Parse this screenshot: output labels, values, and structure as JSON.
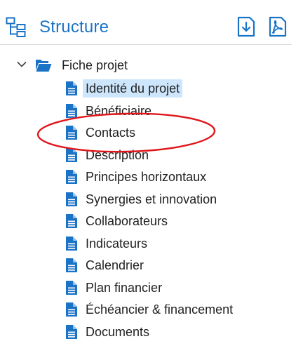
{
  "header": {
    "title": "Structure",
    "icon": "tree-structure-icon",
    "actions": [
      {
        "name": "export-document-icon"
      },
      {
        "name": "export-pdf-icon"
      }
    ]
  },
  "tree": {
    "root": {
      "label": "Fiche projet",
      "expanded": true,
      "icon": "folder-open-icon"
    },
    "items": [
      {
        "label": "Identité du projet",
        "selected": true
      },
      {
        "label": "Bénéficiaire"
      },
      {
        "label": "Contacts"
      },
      {
        "label": "Description"
      },
      {
        "label": "Principes horizontaux"
      },
      {
        "label": "Synergies et innovation"
      },
      {
        "label": "Collaborateurs"
      },
      {
        "label": "Indicateurs"
      },
      {
        "label": "Calendrier"
      },
      {
        "label": "Plan financier"
      },
      {
        "label": "Échéancier & financement"
      },
      {
        "label": "Documents"
      }
    ],
    "item_icon": "document-icon"
  },
  "colors": {
    "accent": "#1a73c6",
    "selection": "#cde6fb",
    "annotation": "#e0161b",
    "text": "#1f1f1f"
  }
}
